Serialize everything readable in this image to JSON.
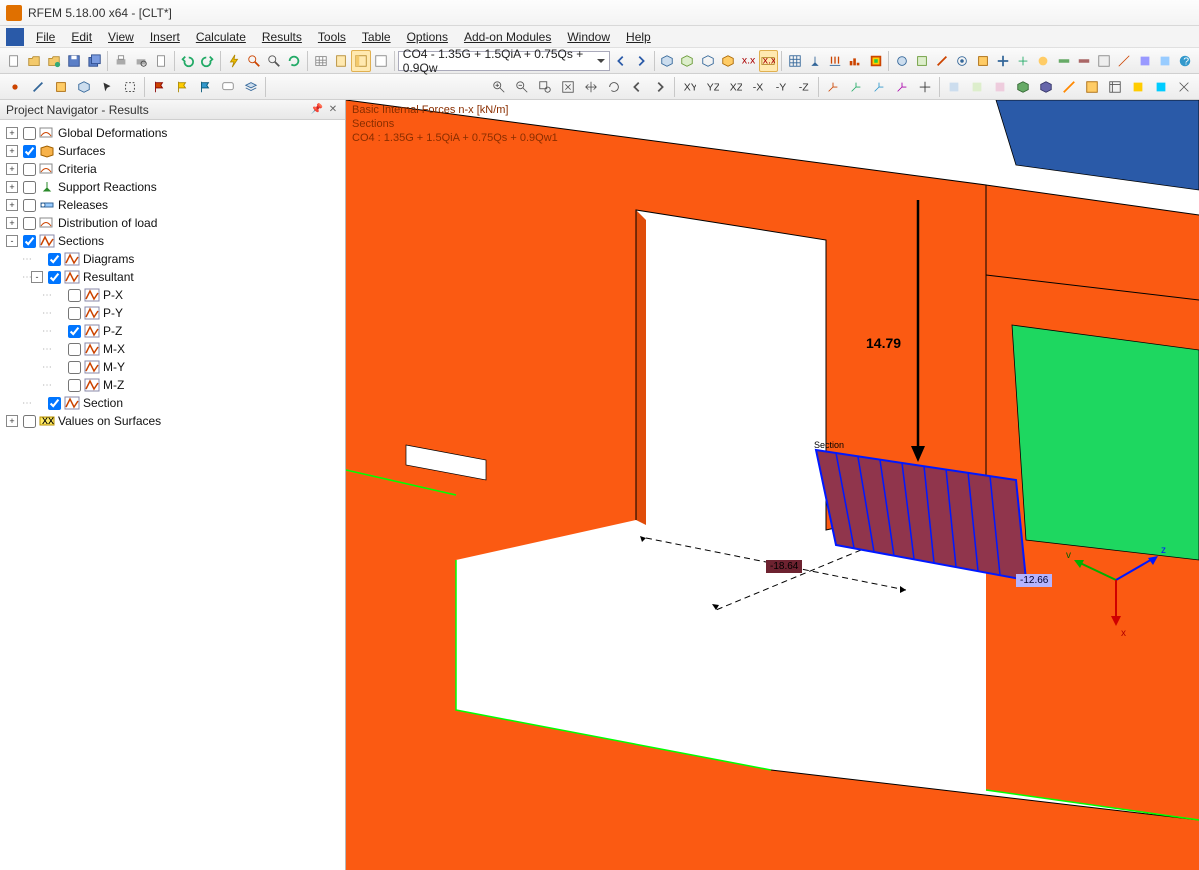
{
  "title": "RFEM 5.18.00 x64 - [CLT*]",
  "menu": [
    "File",
    "Edit",
    "View",
    "Insert",
    "Calculate",
    "Results",
    "Tools",
    "Table",
    "Options",
    "Add-on Modules",
    "Window",
    "Help"
  ],
  "combo": "CO4 - 1.35G + 1.5QiA + 0.75Qs + 0.9Qw",
  "navigator": {
    "title": "Project Navigator - Results",
    "items": [
      {
        "lvl": 0,
        "exp": "+",
        "chk": false,
        "icon": "deform",
        "label": "Global Deformations"
      },
      {
        "lvl": 0,
        "exp": "+",
        "chk": true,
        "icon": "surface",
        "label": "Surfaces"
      },
      {
        "lvl": 0,
        "exp": "+",
        "chk": false,
        "icon": "deform",
        "label": "Criteria"
      },
      {
        "lvl": 0,
        "exp": "+",
        "chk": false,
        "icon": "support",
        "label": "Support Reactions"
      },
      {
        "lvl": 0,
        "exp": "+",
        "chk": false,
        "icon": "release",
        "label": "Releases"
      },
      {
        "lvl": 0,
        "exp": "+",
        "chk": false,
        "icon": "deform",
        "label": "Distribution of load"
      },
      {
        "lvl": 0,
        "exp": "-",
        "chk": true,
        "icon": "section",
        "label": "Sections"
      },
      {
        "lvl": 1,
        "exp": "",
        "chk": true,
        "icon": "section",
        "label": "Diagrams"
      },
      {
        "lvl": 1,
        "exp": "-",
        "chk": true,
        "icon": "section",
        "label": "Resultant"
      },
      {
        "lvl": 2,
        "exp": "",
        "chk": false,
        "icon": "section",
        "label": "P-X"
      },
      {
        "lvl": 2,
        "exp": "",
        "chk": false,
        "icon": "section",
        "label": "P-Y"
      },
      {
        "lvl": 2,
        "exp": "",
        "chk": true,
        "icon": "section",
        "label": "P-Z"
      },
      {
        "lvl": 2,
        "exp": "",
        "chk": false,
        "icon": "section",
        "label": "M-X"
      },
      {
        "lvl": 2,
        "exp": "",
        "chk": false,
        "icon": "section",
        "label": "M-Y"
      },
      {
        "lvl": 2,
        "exp": "",
        "chk": false,
        "icon": "section",
        "label": "M-Z"
      },
      {
        "lvl": 1,
        "exp": "",
        "chk": true,
        "icon": "section",
        "label": "Section"
      },
      {
        "lvl": 0,
        "exp": "+",
        "chk": false,
        "icon": "values",
        "label": "Values on Surfaces"
      }
    ]
  },
  "viewport": {
    "header1": "Basic Internal Forces n-x [kN/m]",
    "header2": "Sections",
    "header3": "CO4 : 1.35G + 1.5QiA + 0.75Qs + 0.9Qw1",
    "force_label": "14.79",
    "section_label": "Section",
    "val_left": "-18.64",
    "val_right": "-12.66",
    "axes": {
      "v": "v",
      "z": "z",
      "x": "x"
    }
  },
  "colors": {
    "wall": "#fb5a12",
    "wall_dark": "#e04d0a",
    "panel_blue": "#2a5aa8",
    "panel_green": "#1ed760",
    "diagram_fill": "#90354c",
    "diagram_stroke": "#0018ff",
    "edge_green": "#00ff00"
  }
}
